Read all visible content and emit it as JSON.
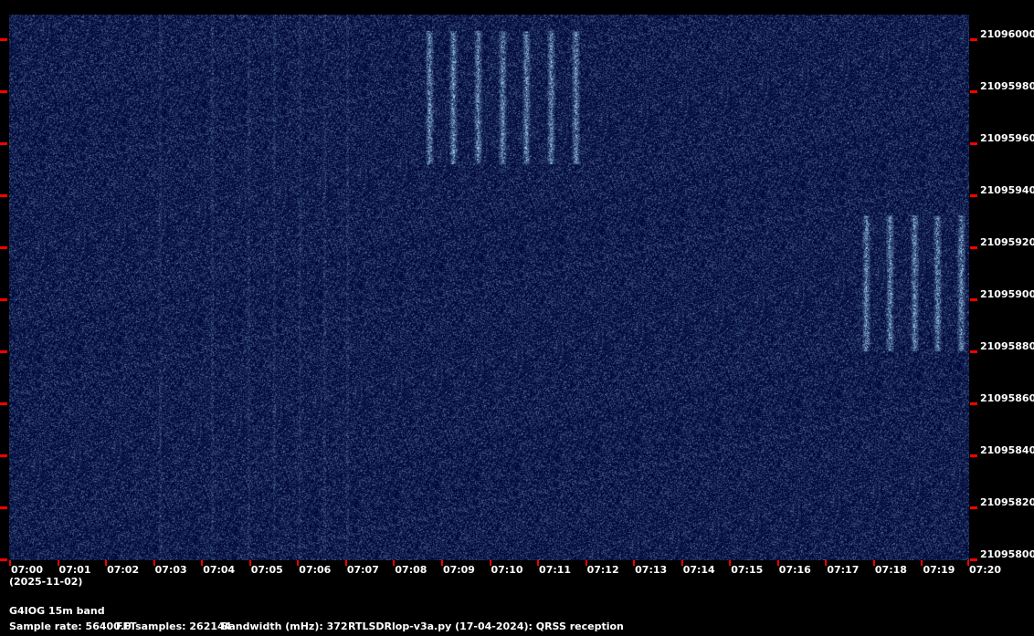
{
  "chart_data": {
    "type": "heatmap",
    "subtype": "spectrogram",
    "colormap": [
      "#000a3c",
      "#0a2a78",
      "#3c78b4",
      "#a0d0f0"
    ],
    "x_ticks": [
      "07:00",
      "07:01",
      "07:02",
      "07:03",
      "07:04",
      "07:05",
      "07:06",
      "07:07",
      "07:08",
      "07:09",
      "07:10",
      "07:11",
      "07:12",
      "07:13",
      "07:14",
      "07:15",
      "07:16",
      "07:17",
      "07:18",
      "07:19",
      "07:20"
    ],
    "x_range_minutes": [
      0,
      20
    ],
    "date_label": "(2025-11-02)",
    "y_ticks": [
      "21096000",
      "21095980",
      "21095960",
      "21095940",
      "21095920",
      "21095900",
      "21095880",
      "21095860",
      "21095840",
      "21095820",
      "21095800"
    ],
    "y_range_hz": [
      21095800,
      21096000
    ],
    "signals": [
      {
        "bars_at_minutes": [
          8.75,
          9.25,
          9.77,
          10.27,
          10.78,
          11.28,
          11.8
        ],
        "freq_hz": [
          21095952,
          21096003
        ]
      },
      {
        "bars_at_minutes": [
          17.85,
          18.35,
          18.85,
          19.33,
          19.83
        ],
        "freq_hz": [
          21095880,
          21095932
        ]
      }
    ],
    "tick_color": "#ff0000"
  },
  "footer": {
    "station": "G4IOG 15m band",
    "sample_rate": "Sample rate: 56400.0",
    "fft_samples": "FFTsamples: 262144",
    "bandwidth": "Bandwidth (mHz): 372",
    "program": "RTLSDRlop-v3a.py (17-04-2024): QRSS reception"
  }
}
